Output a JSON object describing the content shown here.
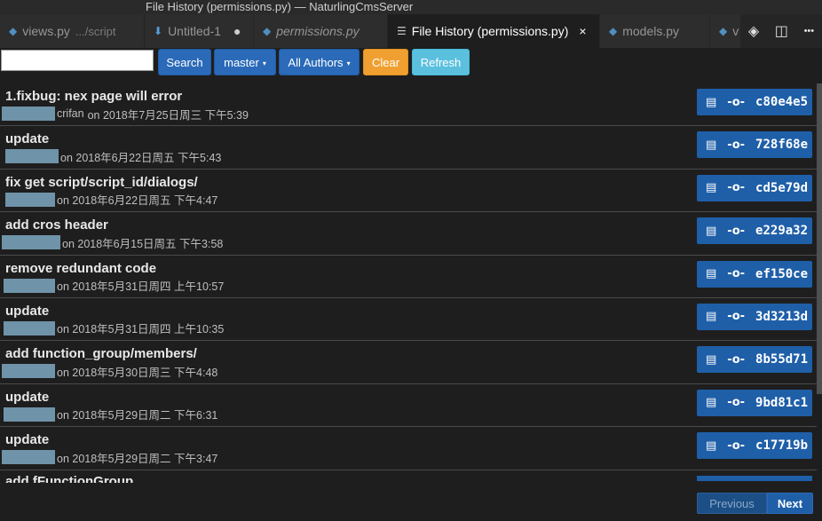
{
  "window": {
    "title": "File History (permissions.py) — NaturlingCmsServer"
  },
  "tabs": [
    {
      "label": "views.py",
      "dir": ".../script",
      "icon": "python-icon",
      "active": false
    },
    {
      "label": "Untitled-1",
      "icon": "download-icon",
      "active": false,
      "dirty": "●"
    },
    {
      "label": "permissions.py",
      "icon": "python-icon",
      "active": false,
      "italic": true
    },
    {
      "label": "File History (permissions.py)",
      "icon": "lines-icon",
      "active": true,
      "close": "×"
    },
    {
      "label": "models.py",
      "icon": "python-icon",
      "active": false
    },
    {
      "label": "v",
      "icon": "python-icon",
      "active": false
    }
  ],
  "tab_actions": {
    "git_icon": "git-compare-icon",
    "split_icon": "split-editor-icon",
    "more_icon": "more-icon",
    "more_glyph": "•••"
  },
  "toolbar": {
    "search_value": "",
    "search_label": "Search",
    "branch_label": "master",
    "authors_label": "All Authors",
    "clear_label": "Clear",
    "refresh_label": "Refresh",
    "caret": "▾"
  },
  "commits": [
    {
      "message": "1.fixbug: nex page will error",
      "author_visible": "crifan",
      "date": "on 2018年7月25日周三 下午5:39",
      "hash": "c80e4e5"
    },
    {
      "message": "update",
      "author_visible": "",
      "date": "on 2018年6月22日周五 下午5:43",
      "hash": "728f68e"
    },
    {
      "message": "fix get script/script_id/dialogs/",
      "author_visible": "",
      "date": "on 2018年6月22日周五 下午4:47",
      "hash": "cd5e79d"
    },
    {
      "message": "add cros header",
      "author_visible": "",
      "date": "on 2018年6月15日周五 下午3:58",
      "hash": "e229a32"
    },
    {
      "message": "remove redundant code",
      "author_visible": "",
      "date": "on 2018年5月31日周四 上午10:57",
      "hash": "ef150ce"
    },
    {
      "message": "update",
      "author_visible": "",
      "date": "on 2018年5月31日周四 上午10:35",
      "hash": "3d3213d"
    },
    {
      "message": "add function_group/members/",
      "author_visible": "",
      "date": "on 2018年5月30日周三 下午4:48",
      "hash": "8b55d71"
    },
    {
      "message": "update",
      "author_visible": "",
      "date": "on 2018年5月29日周二 下午6:31",
      "hash": "9bd81c1"
    },
    {
      "message": "update",
      "author_visible": "",
      "date": "on 2018年5月29日周二 下午3:47",
      "hash": "c17719b"
    }
  ],
  "partial_commit": {
    "message": "add fFunctionGroup"
  },
  "commit_icons": {
    "copy": "clipboard-icon",
    "commit": "git-commit-icon"
  },
  "pager": {
    "previous_label": "Previous",
    "next_label": "Next"
  }
}
